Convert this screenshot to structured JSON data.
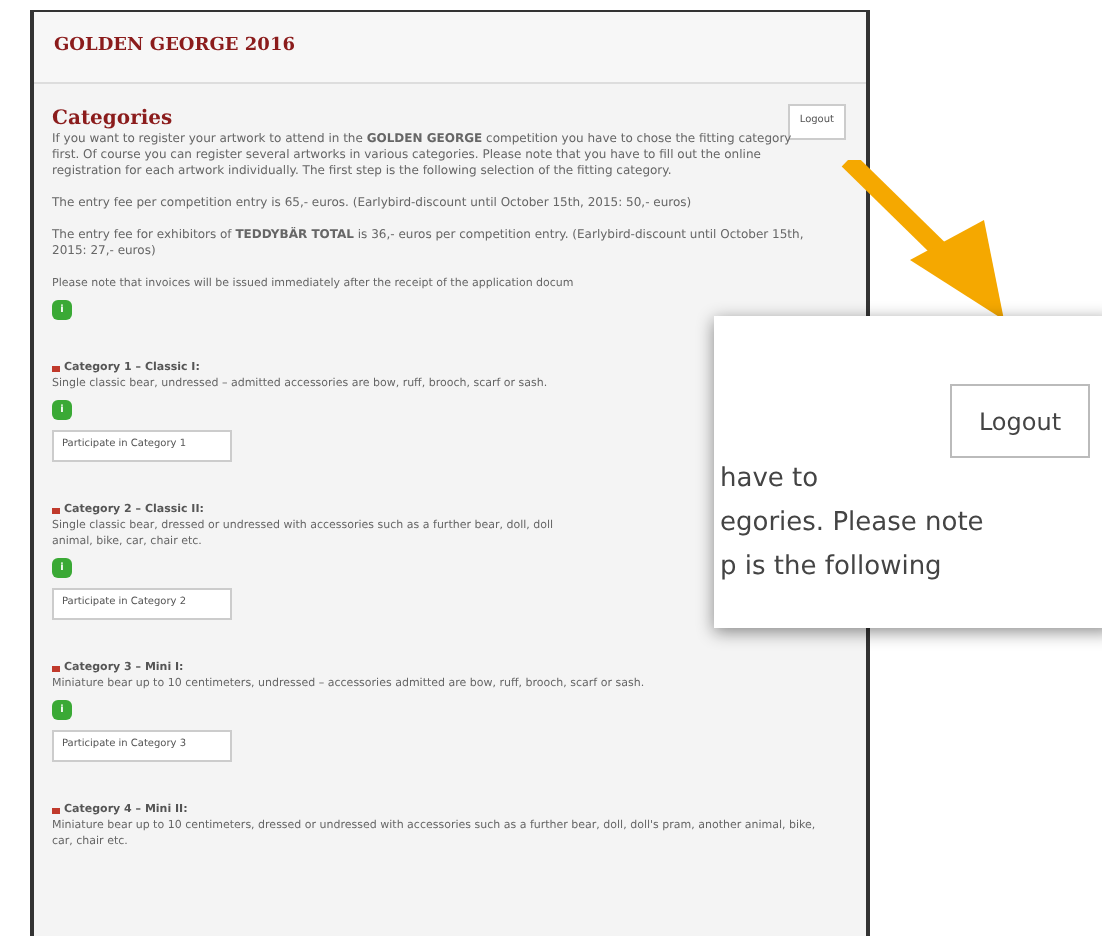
{
  "header": {
    "title": "GOLDEN GEORGE 2016"
  },
  "section": {
    "title": "Categories",
    "logout": "Logout",
    "intro": "If you want to register your artwork to attend in the **GOLDEN GEORGE** competition you have to chose the fitting category first. Of course you can register several artworks in various categories. Please note that you have to fill out the online registration for each artwork individually. The first step is the following selection of the fitting category.",
    "fees": [
      "The entry fee per competition entry is 65,- euros. (Earlybird-discount until October 15th, 2015: 50,- euros)",
      "The entry fee for exhibitors of **TEDDYBÄR TOTAL** is 36,- euros per competition entry. (Earlybird-discount until October 15th, 2015: 27,- euros)"
    ],
    "invoice_note": "Please note that invoices will be issued immediately after the receipt of the application docum",
    "info": "i"
  },
  "categories": [
    {
      "title": "Category 1 – Classic I:",
      "description": [
        "Single classic bear, undressed – admitted accessories are bow, ruff, brooch, scarf or sash."
      ],
      "info": "i",
      "button": "Participate in Category 1"
    },
    {
      "title": "Category 2 – Classic II:",
      "description": [
        "Single classic bear, dressed or undressed with accessories such as a further bear, doll, doll",
        "animal, bike, car, chair etc."
      ],
      "info": "i",
      "button": "Participate in Category 2"
    },
    {
      "title": "Category 3 – Mini I:",
      "description": [
        "Miniature bear up to 10 centimeters, undressed – accessories admitted are bow, ruff, brooch, scarf or sash."
      ],
      "info": "i",
      "button": "Participate in Category 3"
    },
    {
      "title": "Category 4 – Mini II:",
      "description": [
        "Miniature bear up to 10 centimeters, dressed or undressed with accessories such as a further bear, doll, doll's pram, another animal, bike, car, chair etc."
      ]
    }
  ],
  "callout": {
    "logout": "Logout",
    "lines": [
      "have to",
      "egories. Please note",
      "p is the following"
    ]
  }
}
